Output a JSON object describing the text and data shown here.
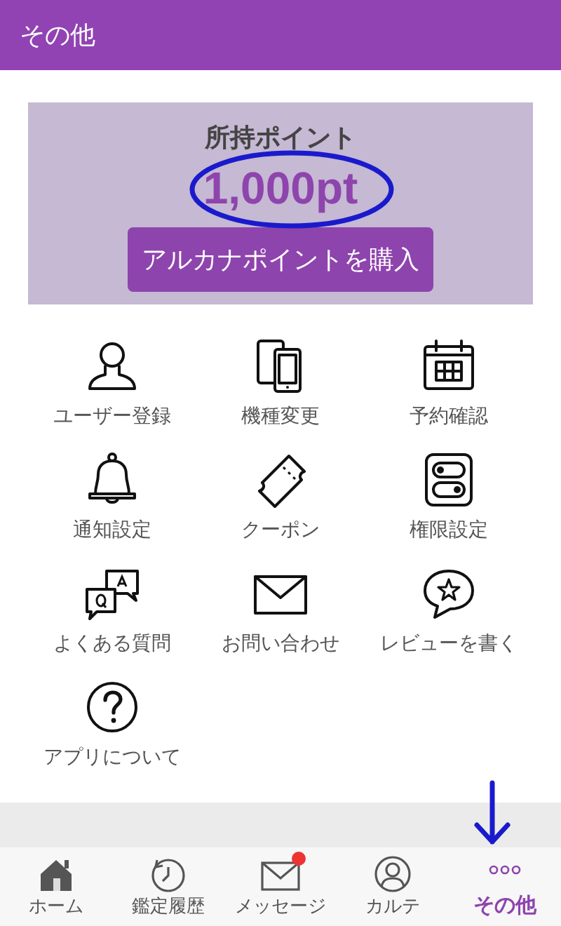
{
  "header": {
    "title": "その他"
  },
  "points": {
    "label": "所持ポイント",
    "value": "1,000pt",
    "button": "アルカナポイントを購入"
  },
  "menu": [
    {
      "kind": "user",
      "label": "ユーザー登録"
    },
    {
      "kind": "devices",
      "label": "機種変更"
    },
    {
      "kind": "calendar",
      "label": "予約確認"
    },
    {
      "kind": "bell",
      "label": "通知設定"
    },
    {
      "kind": "ticket",
      "label": "クーポン"
    },
    {
      "kind": "toggles",
      "label": "権限設定"
    },
    {
      "kind": "qa",
      "label": "よくある質問"
    },
    {
      "kind": "mail",
      "label": "お問い合わせ"
    },
    {
      "kind": "review",
      "label": "レビューを書く"
    },
    {
      "kind": "help",
      "label": "アプリについて"
    }
  ],
  "tabs": [
    {
      "kind": "home",
      "label": "ホーム",
      "selected": false,
      "badge": false
    },
    {
      "kind": "history",
      "label": "鑑定履歴",
      "selected": false,
      "badge": false
    },
    {
      "kind": "mail",
      "label": "メッセージ",
      "selected": false,
      "badge": true
    },
    {
      "kind": "person",
      "label": "カルテ",
      "selected": false,
      "badge": false
    },
    {
      "kind": "more",
      "label": "その他",
      "selected": true,
      "badge": false
    }
  ]
}
